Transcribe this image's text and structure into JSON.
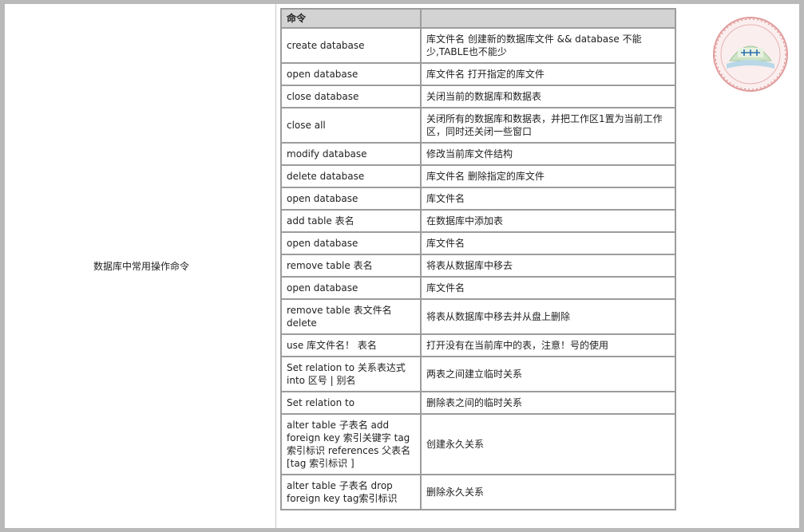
{
  "left_label": "数据库中常用操作命令",
  "table": {
    "headers": [
      "命令",
      ""
    ],
    "rows": [
      {
        "cmd": "create database",
        "desc": "库文件名 创建新的数据库文件 && database 不能少,TABLE也不能少",
        "h": 44
      },
      {
        "cmd": "open database",
        "desc": "库文件名 打开指定的库文件",
        "h": 28
      },
      {
        "cmd": "close database",
        "desc": "关闭当前的数据库和数据表",
        "h": 28
      },
      {
        "cmd": "close all",
        "desc": "关闭所有的数据库和数据表，并把工作区1置为当前工作区，同时还关闭一些窗口",
        "h": 44
      },
      {
        "cmd": "modify database",
        "desc": "修改当前库文件结构",
        "h": 28
      },
      {
        "cmd": "delete database",
        "desc": "库文件名 删除指定的库文件",
        "h": 28
      },
      {
        "cmd": "open database",
        "desc": "库文件名",
        "h": 28
      },
      {
        "cmd": "add table 表名",
        "desc": "在数据库中添加表",
        "h": 28
      },
      {
        "cmd": "open database",
        "desc": "库文件名",
        "h": 28
      },
      {
        "cmd": "remove table 表名",
        "desc": "将表从数据库中移去",
        "h": 28
      },
      {
        "cmd": "open database",
        "desc": "库文件名",
        "h": 28
      },
      {
        "cmd": "remove table 表文件名 delete",
        "desc": "将表从数据库中移去并从盘上删除",
        "h": 44
      },
      {
        "cmd": "use 库文件名！ 表名",
        "desc": "打开没有在当前库中的表，注意！号的使用",
        "h": 28
      },
      {
        "cmd": "Set relation to 关系表达式 into 区号 | 别名",
        "desc": "两表之间建立临时关系",
        "h": 44
      },
      {
        "cmd": "Set relation to",
        "desc": "删除表之间的临时关系",
        "h": 28
      },
      {
        "cmd": "alter table 子表名 add foreign key 索引关键字 tag 索引标识 references 父表名 [tag 索引标识 ]",
        "desc": "创建永久关系",
        "h": 76
      },
      {
        "cmd": "alter table 子表名 drop foreign key tag索引标识",
        "desc": "删除永久关系",
        "h": 44
      }
    ]
  },
  "seal": {
    "icon": "school-seal-logo",
    "colors": {
      "ring": "#e09a9a",
      "inner": "#cfe3c6",
      "text": "#c94a4a",
      "center": "#2e6fb0"
    }
  }
}
